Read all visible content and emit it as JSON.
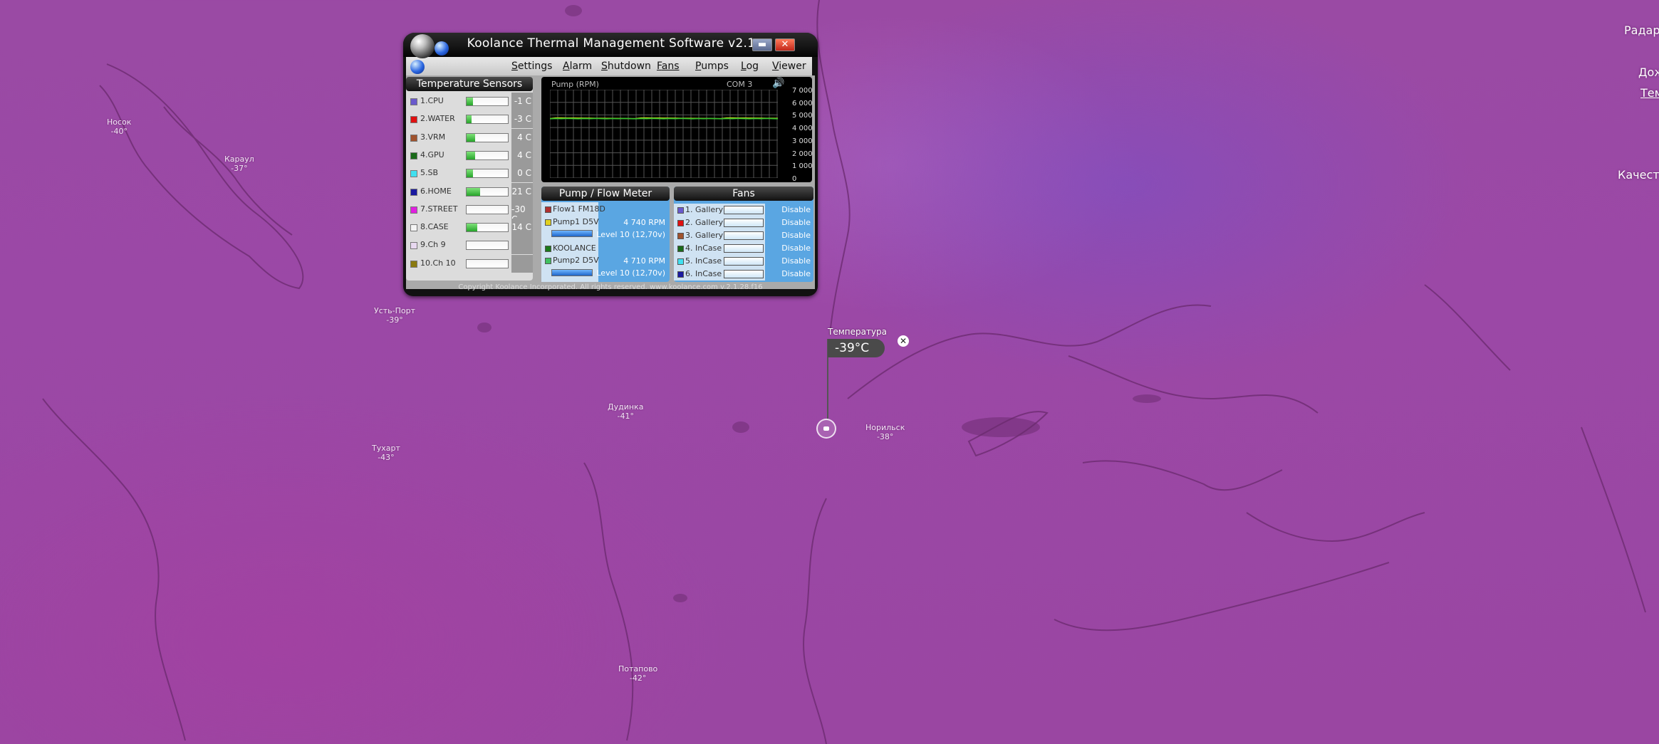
{
  "map": {
    "cities": [
      {
        "name": "Носок",
        "temp": "-40°"
      },
      {
        "name": "Караул",
        "temp": "-37°"
      },
      {
        "name": "Усть-Порт",
        "temp": "-39°"
      },
      {
        "name": "Дудинка",
        "temp": "-41°"
      },
      {
        "name": "Тухарт",
        "temp": "-43°"
      },
      {
        "name": "Норильск",
        "temp": "-38°"
      },
      {
        "name": "Потапово",
        "temp": "-42°"
      }
    ],
    "side_menu": [
      "Радар",
      "Дож",
      "Тем",
      "Качеств"
    ],
    "popup": {
      "label": "Температура",
      "value": "-39°C",
      "close": "✕"
    }
  },
  "koolance": {
    "title": "Koolance Thermal Management Software v2.1",
    "min_symbol": "▬",
    "close_symbol": "✕",
    "menu": [
      {
        "label": "Settings",
        "u": "S",
        "rest": "ettings"
      },
      {
        "label": "Alarm",
        "u": "A",
        "rest": "larm"
      },
      {
        "label": "Shutdown",
        "u": "S",
        "rest": "hutdown"
      },
      {
        "label": "Fans",
        "u": "F",
        "rest": "ans"
      },
      {
        "label": "Pumps",
        "u": "P",
        "rest": "umps"
      },
      {
        "label": "Log",
        "u": "L",
        "rest": "og"
      },
      {
        "label": "Viewer",
        "u": "V",
        "rest": "iewer"
      }
    ],
    "temperature_sensors": {
      "header": "Temperature Sensors",
      "sensors": [
        {
          "name": "1.CPU",
          "value": "-1 C",
          "color": "#6a5acd",
          "level": 0.15
        },
        {
          "name": "2.WATER",
          "value": "-3 C",
          "color": "#e01010",
          "level": 0.12
        },
        {
          "name": "3.VRM",
          "value": "4 C",
          "color": "#a0522d",
          "level": 0.2
        },
        {
          "name": "4.GPU",
          "value": "4 C",
          "color": "#1a6a1a",
          "level": 0.2
        },
        {
          "name": "5.SB",
          "value": "0 C",
          "color": "#40e0f0",
          "level": 0.15
        },
        {
          "name": "6.HOME",
          "value": "21 C",
          "color": "#1a1aa0",
          "level": 0.32
        },
        {
          "name": "7.STREET",
          "value": "-30 C",
          "color": "#e020e0",
          "level": 0.0
        },
        {
          "name": "8.CASE",
          "value": "14 C",
          "color": "#f4f4f4",
          "level": 0.25
        },
        {
          "name": "9.Ch 9",
          "value": "",
          "color": "#e8d8f0",
          "level": 0.0
        },
        {
          "name": "10.Ch 10",
          "value": "",
          "color": "#8a7a10",
          "level": 0.0
        }
      ]
    },
    "pump_graph": {
      "title": "Pump (RPM)",
      "com": "COM 3",
      "speaker": "🔊",
      "y_ticks": [
        "7 000",
        "6 000",
        "5 000",
        "4 000",
        "3 000",
        "2 000",
        "1 000",
        "0"
      ]
    },
    "pump_flow": {
      "header": "Pump / Flow Meter",
      "items": [
        {
          "label": "Flow1 FM18D",
          "color": "#b03030",
          "value": "",
          "level": ""
        },
        {
          "label": "Pump1 D5V",
          "color": "#e0d020",
          "value": "4 740 RPM",
          "level": "Level 10 (12,70v)"
        },
        {
          "label": "KOOLANCE",
          "color": "#1a7a1a",
          "value": "",
          "level": ""
        },
        {
          "label": "Pump2 D5V",
          "color": "#40c060",
          "value": "4 710 RPM",
          "level": "Level 10 (12,70v)"
        }
      ]
    },
    "fans": {
      "header": "Fans",
      "items": [
        {
          "name": "1. Gallery",
          "color": "#6a5acd",
          "action": "Disable"
        },
        {
          "name": "2. Gallery",
          "color": "#e01010",
          "action": "Disable"
        },
        {
          "name": "3. Gallery",
          "color": "#a0522d",
          "action": "Disable"
        },
        {
          "name": "4. InCase",
          "color": "#1a6a1a",
          "action": "Disable"
        },
        {
          "name": "5. InCase",
          "color": "#40e0f0",
          "action": "Disable"
        },
        {
          "name": "6. InCase",
          "color": "#1a1aa0",
          "action": "Disable"
        }
      ]
    },
    "footer": "Copyright Koolance Incorporated. All rights reserved. www.koolance.com v.2.1.28.f16"
  }
}
